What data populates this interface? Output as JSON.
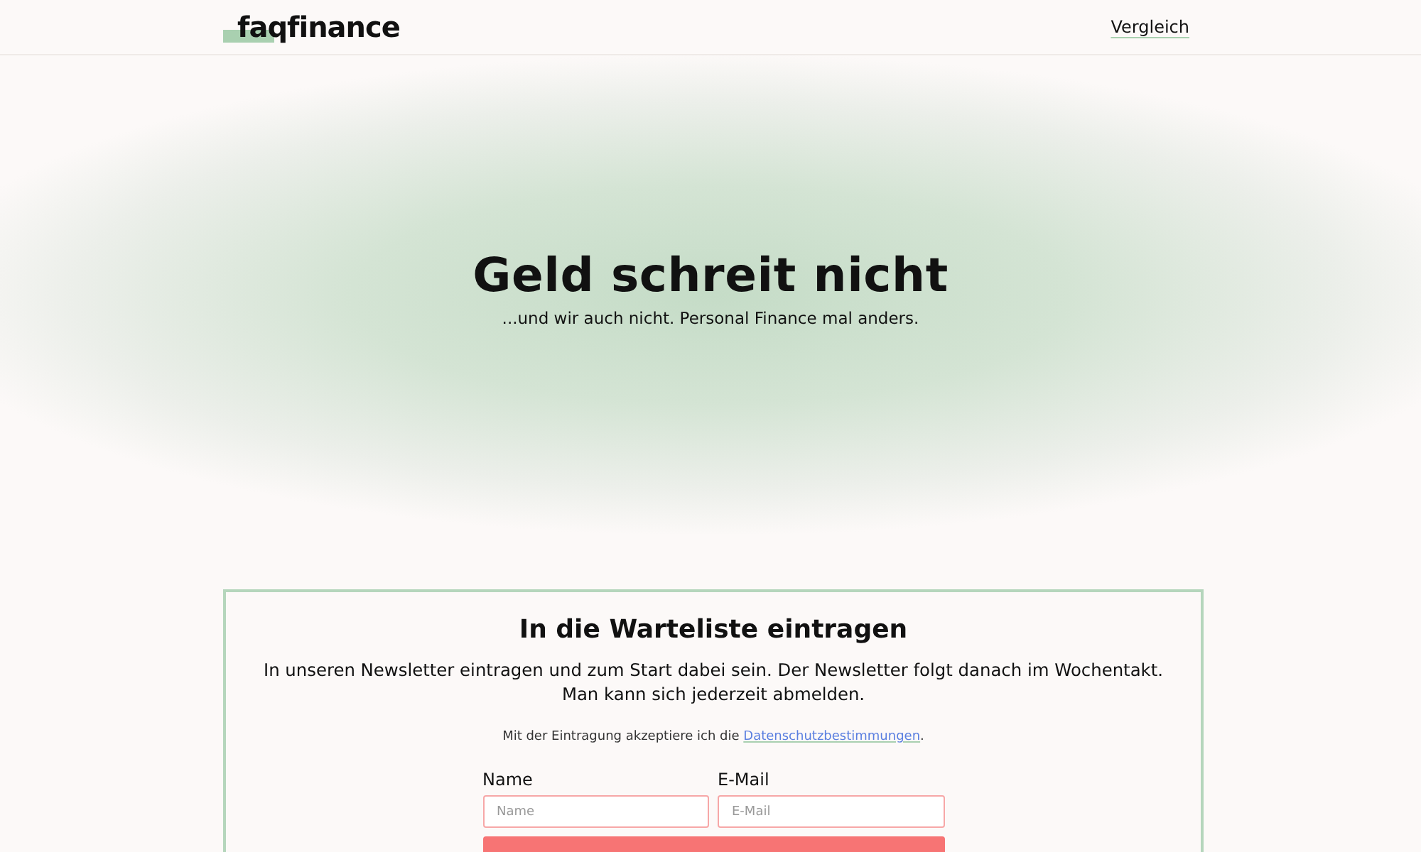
{
  "header": {
    "logo": "faqfinance",
    "nav": [
      {
        "label": "Vergleich"
      }
    ]
  },
  "hero": {
    "title": "Geld schreit nicht",
    "subtitle": "...und wir auch nicht. Personal Finance mal anders."
  },
  "signup": {
    "title": "In die Warteliste eintragen",
    "description": "In unseren Newsletter eintragen und zum Start dabei sein. Der Newsletter folgt danach im Wochentakt. Man kann sich jederzeit abmelden.",
    "consent_before": "Mit der Eintragung akzeptiere ich die ",
    "consent_link": "Datenschutzbestimmungen",
    "consent_after": ".",
    "fields": [
      {
        "label": "Name",
        "placeholder": "Name"
      },
      {
        "label": "E-Mail",
        "placeholder": "E-Mail"
      }
    ]
  }
}
